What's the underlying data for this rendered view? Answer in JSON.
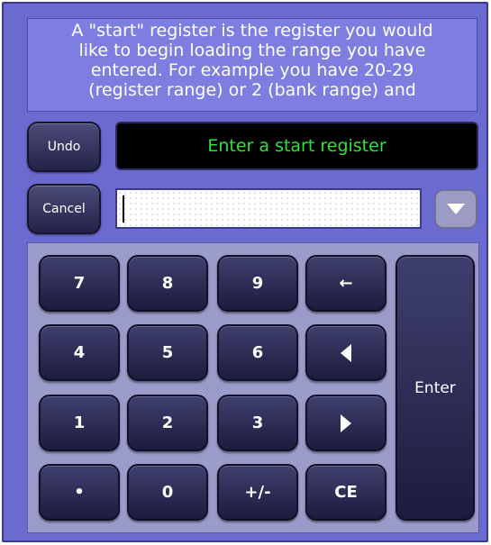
{
  "help_text": {
    "line1": "A \"start\" register is the register you would",
    "line2": "like to begin loading the range you have",
    "line3": "entered. For example you have 20-29",
    "line4": "(register range) or 2 (bank range) and"
  },
  "buttons": {
    "undo": "Undo",
    "cancel": "Cancel"
  },
  "prompt": "Enter a start register",
  "entry": {
    "value": ""
  },
  "keys": {
    "k7": "7",
    "k8": "8",
    "k9": "9",
    "k4": "4",
    "k5": "5",
    "k6": "6",
    "k1": "1",
    "k2": "2",
    "k3": "3",
    "dot": "•",
    "k0": "0",
    "plusminus": "+/-",
    "ce": "CE",
    "backspace": "←",
    "enter": "Enter"
  },
  "icons": {
    "dropdown": "chevron-down-icon",
    "left_arrow": "triangle-left-icon",
    "right_arrow": "triangle-right-icon",
    "backspace": "backspace-arrow-icon"
  },
  "colors": {
    "panel_bg": "#6a6ad0",
    "prompt_text": "#33e13b",
    "key_bg": "#2a2a52"
  }
}
